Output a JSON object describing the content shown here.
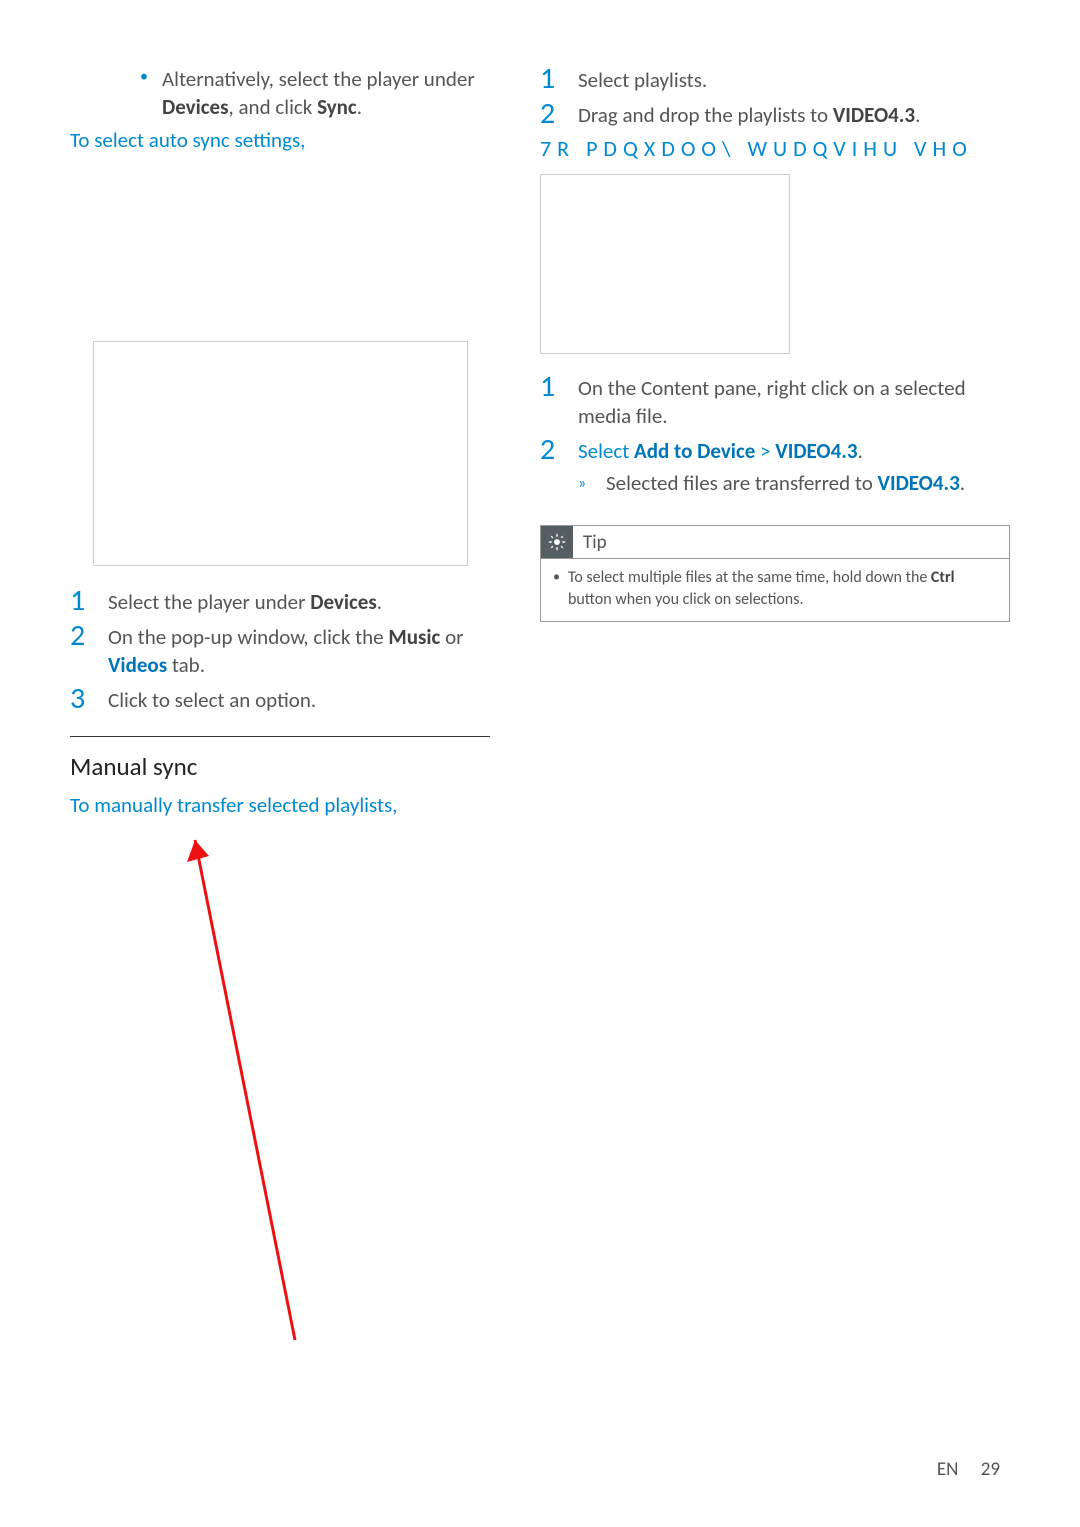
{
  "left": {
    "bullet": {
      "pre": "Alternatively, select the player under ",
      "b1": "Devices",
      "mid": ", and click ",
      "b2": "Sync",
      "post": "."
    },
    "lead": "To select auto sync settings,",
    "steps": {
      "n1": "1",
      "s1a": "Select the player under ",
      "s1b": "Devices",
      "s1c": ".",
      "n2": "2",
      "s2a": "On the pop-up window, click the ",
      "s2b": "Music",
      "s2c": " or ",
      "s2d": "Videos",
      "s2e": " tab.",
      "n3": "3",
      "s3": "Click to select an option."
    },
    "subheading": "Manual sync",
    "lead2": "To manually transfer selected playlists,"
  },
  "right": {
    "top_steps": {
      "n1": "1",
      "s1": "Select playlists.",
      "n2": "2",
      "s2a": "Drag and drop the playlists to ",
      "s2b": "VIDEO4.3",
      "s2c": "."
    },
    "garbled": "7R PDQXDOO\\ WUDQVIHU VHO",
    "mid_steps": {
      "n1": "1",
      "s1": "On the Content pane, right click on a selected media file.",
      "n2": "2",
      "s2a": "Select ",
      "s2b": "Add to Device",
      "s2c": " > ",
      "s2d": "VIDEO4.3",
      "s2e": ".",
      "suba": "Selected files are transferred to ",
      "subb": "VIDEO4.3",
      "subc": "."
    },
    "tip": {
      "label": "Tip",
      "body_a": "To select multiple files at the same time, hold down the ",
      "body_b": "Ctrl",
      "body_c": " button when you click on selections."
    }
  },
  "footer": {
    "lang": "EN",
    "page": "29"
  }
}
